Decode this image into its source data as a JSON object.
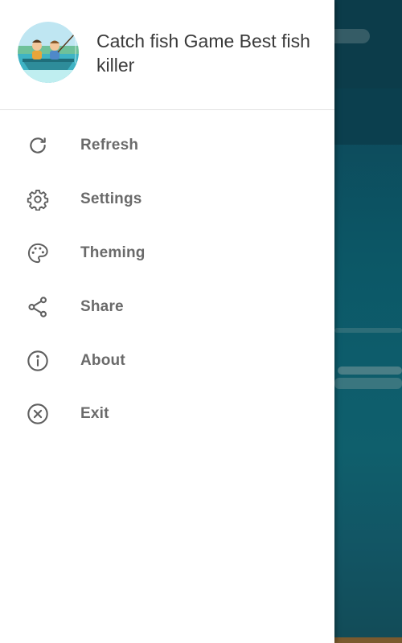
{
  "drawer": {
    "app_title": "Catch fish Game Best fish killer",
    "avatar_icon": "fishing-boat-avatar-icon",
    "items": [
      {
        "label": "Refresh",
        "icon": "refresh-icon"
      },
      {
        "label": "Settings",
        "icon": "gear-icon"
      },
      {
        "label": "Theming",
        "icon": "palette-icon"
      },
      {
        "label": "Share",
        "icon": "share-icon"
      },
      {
        "label": "About",
        "icon": "info-icon"
      },
      {
        "label": "Exit",
        "icon": "close-circle-icon"
      }
    ]
  },
  "colors": {
    "drawer_background": "#ffffff",
    "title_text": "#3a3a3a",
    "label_text": "#6a6a6a",
    "icon_stroke": "#5f5f5f",
    "background_water": "#0d5c6b"
  }
}
